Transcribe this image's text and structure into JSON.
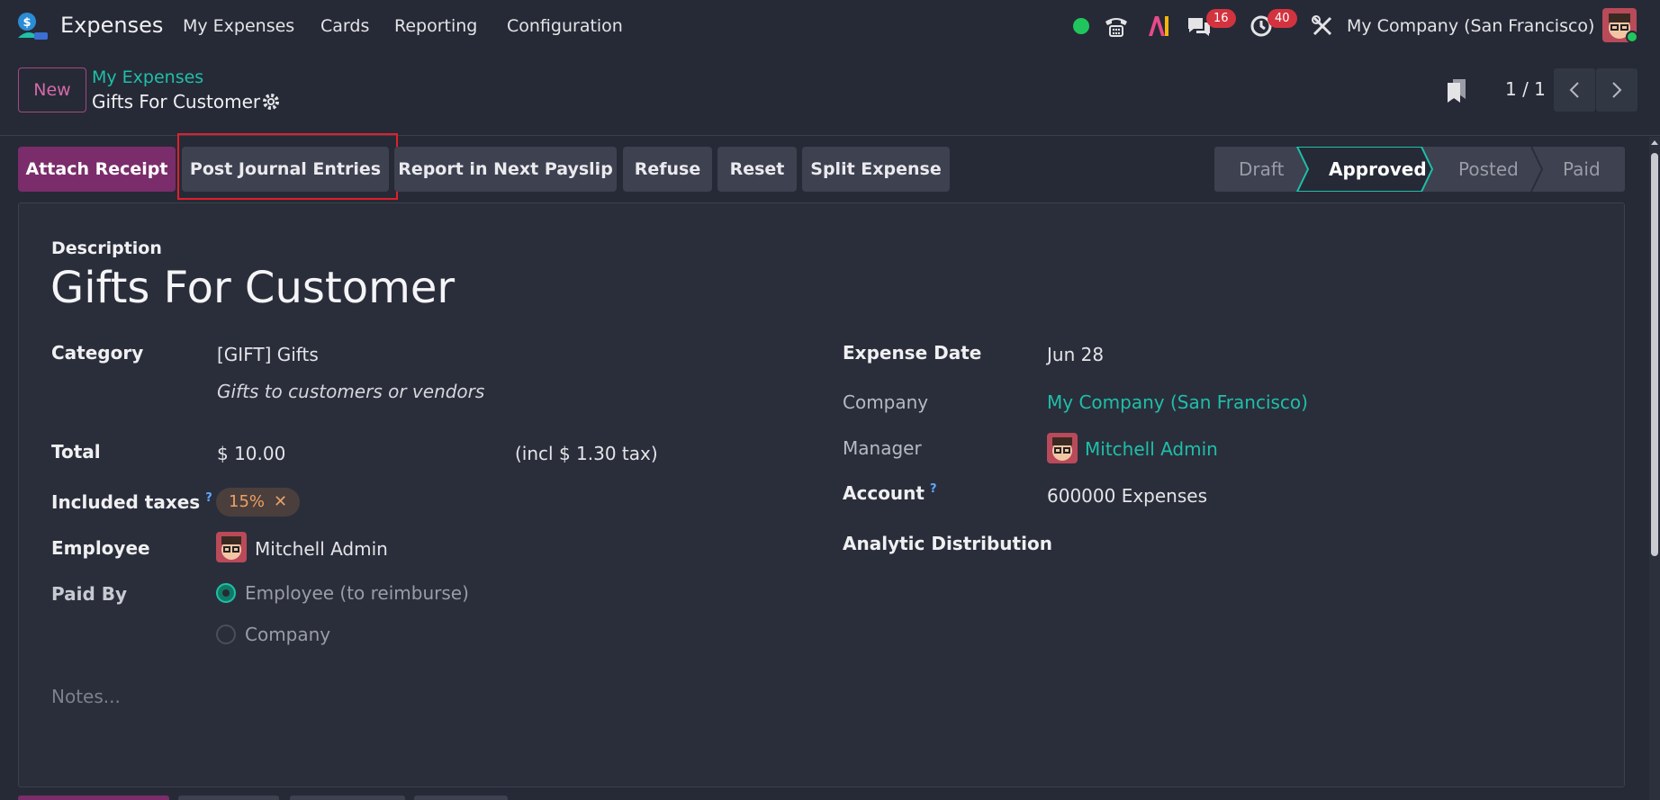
{
  "navbar": {
    "app_name": "Expenses",
    "menu": [
      "My Expenses",
      "Cards",
      "Reporting",
      "Configuration"
    ],
    "messages_count": "16",
    "activities_count": "40",
    "company": "My Company (San Francisco)"
  },
  "control": {
    "new_label": "New",
    "breadcrumb_parent": "My Expenses",
    "breadcrumb_current": "Gifts For Customer",
    "pager": "1 / 1"
  },
  "actions": {
    "attach_receipt": "Attach Receipt",
    "post_journal": "Post Journal Entries",
    "report_payslip": "Report in Next Payslip",
    "refuse": "Refuse",
    "reset": "Reset",
    "split": "Split Expense"
  },
  "statusbar": {
    "stages": [
      "Draft",
      "Approved",
      "Posted",
      "Paid"
    ],
    "current": "Approved"
  },
  "form": {
    "description_label": "Description",
    "title": "Gifts For Customer",
    "category_label": "Category",
    "category_value": "[GIFT] Gifts",
    "category_note": "Gifts to customers or vendors",
    "total_label": "Total",
    "total_value": "$ 10.00",
    "total_tax": "(incl $ 1.30 tax)",
    "taxes_label": "Included taxes",
    "taxes_help": "?",
    "tax_tag": "15%",
    "employee_label": "Employee",
    "employee_value": "Mitchell Admin",
    "paid_by_label": "Paid By",
    "paid_by_options": [
      "Employee (to reimburse)",
      "Company"
    ],
    "expense_date_label": "Expense Date",
    "expense_date_value": "Jun 28",
    "company_label": "Company",
    "company_value": "My Company (San Francisco)",
    "manager_label": "Manager",
    "manager_value": "Mitchell Admin",
    "account_label": "Account",
    "account_help": "?",
    "account_value": "600000 Expenses",
    "analytic_label": "Analytic Distribution",
    "notes_placeholder": "Notes..."
  },
  "colors": {
    "accent": "#1fbfa9",
    "primary": "#7a2d6a",
    "highlight": "#e0202a"
  }
}
